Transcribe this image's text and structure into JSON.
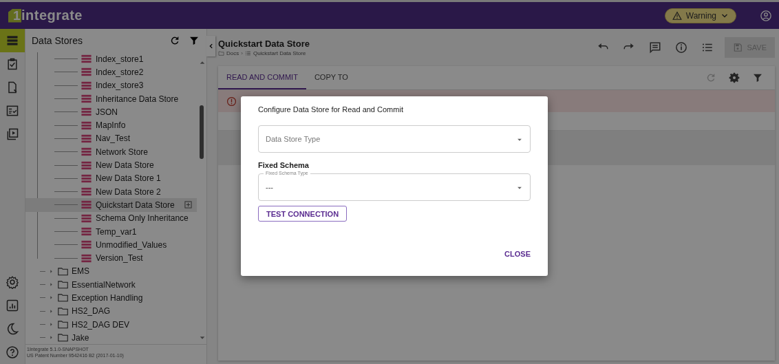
{
  "header": {
    "logo_mark": "1",
    "logo_text": "integrate",
    "warning": {
      "label": "Warning"
    }
  },
  "rail": {
    "top": [
      {
        "selected": true
      },
      {
        "selected": false
      },
      {
        "selected": false
      },
      {
        "selected": false
      },
      {
        "selected": false
      }
    ]
  },
  "sidebar": {
    "title": "Data Stores",
    "tree": [
      {
        "kind": "store",
        "label": "Index_store1",
        "selected": false
      },
      {
        "kind": "store",
        "label": "Index_store2",
        "selected": false
      },
      {
        "kind": "store",
        "label": "Index_store3",
        "selected": false
      },
      {
        "kind": "store",
        "label": "Inheritance Data Store",
        "selected": false
      },
      {
        "kind": "store",
        "label": "JSON",
        "selected": false
      },
      {
        "kind": "store",
        "label": "MapInfo",
        "selected": false
      },
      {
        "kind": "store",
        "label": "Nav_Test",
        "selected": false
      },
      {
        "kind": "store",
        "label": "Network Store",
        "selected": false
      },
      {
        "kind": "store",
        "label": "New Data Store",
        "selected": false
      },
      {
        "kind": "store",
        "label": "New Data Store 1",
        "selected": false
      },
      {
        "kind": "store",
        "label": "New Data Store 2",
        "selected": false
      },
      {
        "kind": "store",
        "label": "Quickstart Data Store",
        "selected": true
      },
      {
        "kind": "store",
        "label": "Schema Only Inheritance",
        "selected": false
      },
      {
        "kind": "store",
        "label": "Temp_var1",
        "selected": false
      },
      {
        "kind": "store",
        "label": "Unmodified_Values",
        "selected": false
      },
      {
        "kind": "store",
        "label": "Version_Test",
        "selected": false
      },
      {
        "kind": "folder",
        "label": "EMS",
        "expanded": false
      },
      {
        "kind": "folder",
        "label": "EssentialNetwork",
        "expanded": false
      },
      {
        "kind": "folder",
        "label": "Exception Handling",
        "expanded": false
      },
      {
        "kind": "folder",
        "label": "HS2_DAG",
        "expanded": false
      },
      {
        "kind": "folder",
        "label": "HS2_DAG DEV",
        "expanded": false
      },
      {
        "kind": "folder",
        "label": "Jake",
        "expanded": false
      }
    ],
    "footer": [
      "1Integrate 5.1.0-SNAPSHOT",
      "US Patent Number 9542416 B2 (2017-01-10)"
    ]
  },
  "main": {
    "title": "Quickstart Data Store",
    "breadcrumb": [
      "Docs",
      "Quickstart Data Store"
    ],
    "breadcrumb_separator": "›",
    "save": {
      "label": "SAVE",
      "disabled": true
    },
    "tabs": [
      {
        "label": "READ AND COMMIT",
        "selected": true
      },
      {
        "label": "COPY TO",
        "selected": false
      }
    ],
    "refresh_disabled": true
  },
  "dialog": {
    "title": "Configure Data Store for Read and Commit",
    "data_store_type": {
      "placeholder": "Data Store Type"
    },
    "section": "Fixed Schema",
    "fixed_schema_type": {
      "label": "Fixed Schema Type",
      "value": "---"
    },
    "test_button": "TEST CONNECTION",
    "close_button": "CLOSE"
  }
}
